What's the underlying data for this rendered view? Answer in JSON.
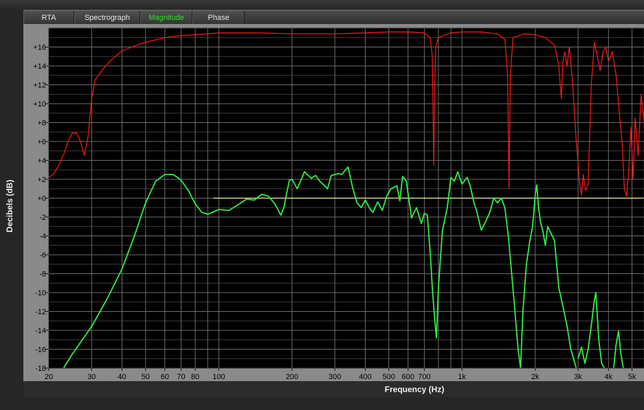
{
  "tabs": [
    {
      "label": "RTA",
      "active": false
    },
    {
      "label": "Spectrograph",
      "active": false
    },
    {
      "label": "Magnitude",
      "active": true
    },
    {
      "label": "Phase",
      "active": false
    }
  ],
  "colors": {
    "plot_bg": "#000000",
    "grid": "#6e6e6e",
    "red_trace": "#ff1a1a",
    "green_trace": "#33ee44",
    "zero_line": "#f3f39a",
    "active_tab": "#2fe02f"
  },
  "chart_data": {
    "type": "line",
    "title": "",
    "xlabel": "Frequency (Hz)",
    "ylabel": "Decibels (dB)",
    "x_scale": "log",
    "xlim": [
      20,
      5600
    ],
    "ylim": [
      -18,
      18
    ],
    "grid": true,
    "x_ticks": [
      {
        "v": 20,
        "label": "20"
      },
      {
        "v": 30,
        "label": "30"
      },
      {
        "v": 40,
        "label": "40"
      },
      {
        "v": 50,
        "label": "50"
      },
      {
        "v": 60,
        "label": "60"
      },
      {
        "v": 70,
        "label": "70"
      },
      {
        "v": 80,
        "label": "80"
      },
      {
        "v": 100,
        "label": "100"
      },
      {
        "v": 200,
        "label": "200"
      },
      {
        "v": 300,
        "label": "300"
      },
      {
        "v": 400,
        "label": "400"
      },
      {
        "v": 500,
        "label": "500"
      },
      {
        "v": 600,
        "label": "600"
      },
      {
        "v": 700,
        "label": "700"
      },
      {
        "v": 1000,
        "label": "1k"
      },
      {
        "v": 2000,
        "label": "2k"
      },
      {
        "v": 3000,
        "label": "3k"
      },
      {
        "v": 4000,
        "label": "4k"
      },
      {
        "v": 5000,
        "label": "5k"
      }
    ],
    "y_ticks": [
      {
        "v": 16,
        "label": "+16"
      },
      {
        "v": 14,
        "label": "+14"
      },
      {
        "v": 12,
        "label": "+12"
      },
      {
        "v": 10,
        "label": "+10"
      },
      {
        "v": 8,
        "label": "+8"
      },
      {
        "v": 6,
        "label": "+6"
      },
      {
        "v": 4,
        "label": "+4"
      },
      {
        "v": 2,
        "label": "+2"
      },
      {
        "v": 0,
        "label": "+0"
      },
      {
        "v": -2,
        "label": "-2"
      },
      {
        "v": -4,
        "label": "-4"
      },
      {
        "v": -6,
        "label": "-6"
      },
      {
        "v": -8,
        "label": "-8"
      },
      {
        "v": -10,
        "label": "-10"
      },
      {
        "v": -12,
        "label": "-12"
      },
      {
        "v": -14,
        "label": "-14"
      },
      {
        "v": -16,
        "label": "-16"
      },
      {
        "v": -18,
        "label": "-18"
      }
    ],
    "reference_line": {
      "y": 0,
      "x_start": 95,
      "x_end": 5600
    },
    "series": [
      {
        "color": "red",
        "points": [
          [
            20,
            2.2
          ],
          [
            21,
            2.6
          ],
          [
            22,
            3.5
          ],
          [
            23,
            4.6
          ],
          [
            24,
            6.0
          ],
          [
            25,
            6.9
          ],
          [
            26,
            6.9
          ],
          [
            27,
            6.0
          ],
          [
            28,
            4.5
          ],
          [
            29,
            6.5
          ],
          [
            30,
            10.5
          ],
          [
            31,
            12.5
          ],
          [
            33,
            13.5
          ],
          [
            36,
            14.6
          ],
          [
            40,
            15.6
          ],
          [
            45,
            16.1
          ],
          [
            50,
            16.5
          ],
          [
            60,
            17.0
          ],
          [
            70,
            17.2
          ],
          [
            80,
            17.3
          ],
          [
            100,
            17.5
          ],
          [
            150,
            17.5
          ],
          [
            200,
            17.4
          ],
          [
            300,
            17.4
          ],
          [
            400,
            17.5
          ],
          [
            500,
            17.6
          ],
          [
            600,
            17.6
          ],
          [
            700,
            17.5
          ],
          [
            740,
            17.0
          ],
          [
            755,
            15.0
          ],
          [
            765,
            3.5
          ],
          [
            772,
            12.0
          ],
          [
            780,
            16.0
          ],
          [
            800,
            17.0
          ],
          [
            900,
            17.5
          ],
          [
            1000,
            17.6
          ],
          [
            1200,
            17.6
          ],
          [
            1400,
            17.4
          ],
          [
            1500,
            16.8
          ],
          [
            1540,
            13.0
          ],
          [
            1560,
            1.0
          ],
          [
            1580,
            13.0
          ],
          [
            1620,
            17.0
          ],
          [
            1800,
            17.4
          ],
          [
            2000,
            17.3
          ],
          [
            2200,
            17.0
          ],
          [
            2400,
            16.2
          ],
          [
            2500,
            14.0
          ],
          [
            2560,
            10.5
          ],
          [
            2600,
            14.5
          ],
          [
            2650,
            15.5
          ],
          [
            2700,
            14.0
          ],
          [
            2760,
            16.0
          ],
          [
            2850,
            12.0
          ],
          [
            2950,
            6.0
          ],
          [
            3050,
            1.5
          ],
          [
            3100,
            0.3
          ],
          [
            3150,
            2.5
          ],
          [
            3220,
            0.8
          ],
          [
            3300,
            1.5
          ],
          [
            3400,
            12.0
          ],
          [
            3500,
            16.5
          ],
          [
            3600,
            15.0
          ],
          [
            3700,
            13.5
          ],
          [
            3800,
            15.5
          ],
          [
            3900,
            16.0
          ],
          [
            4000,
            14.5
          ],
          [
            4150,
            15.5
          ],
          [
            4300,
            13.0
          ],
          [
            4450,
            8.5
          ],
          [
            4550,
            6.0
          ],
          [
            4650,
            1.0
          ],
          [
            4750,
            0.2
          ],
          [
            4850,
            3.0
          ],
          [
            4950,
            7.5
          ],
          [
            5050,
            2.0
          ],
          [
            5150,
            8.5
          ],
          [
            5300,
            4.5
          ],
          [
            5450,
            11.0
          ],
          [
            5600,
            8.0
          ]
        ]
      },
      {
        "color": "green",
        "points": [
          [
            23,
            -18
          ],
          [
            25,
            -16.5
          ],
          [
            30,
            -13.6
          ],
          [
            35,
            -10.5
          ],
          [
            40,
            -7.5
          ],
          [
            45,
            -4.0
          ],
          [
            50,
            -0.5
          ],
          [
            55,
            1.8
          ],
          [
            60,
            2.5
          ],
          [
            65,
            2.5
          ],
          [
            70,
            1.9
          ],
          [
            75,
            0.8
          ],
          [
            80,
            -0.6
          ],
          [
            85,
            -1.5
          ],
          [
            90,
            -1.7
          ],
          [
            100,
            -1.2
          ],
          [
            110,
            -1.3
          ],
          [
            120,
            -0.7
          ],
          [
            130,
            -0.1
          ],
          [
            140,
            -0.2
          ],
          [
            150,
            0.4
          ],
          [
            160,
            0.2
          ],
          [
            170,
            -0.6
          ],
          [
            180,
            -1.8
          ],
          [
            185,
            -1.0
          ],
          [
            195,
            1.9
          ],
          [
            200,
            2.0
          ],
          [
            210,
            1.0
          ],
          [
            215,
            1.6
          ],
          [
            225,
            2.8
          ],
          [
            240,
            2.1
          ],
          [
            250,
            2.4
          ],
          [
            260,
            1.8
          ],
          [
            270,
            1.4
          ],
          [
            280,
            1.0
          ],
          [
            290,
            2.4
          ],
          [
            310,
            2.6
          ],
          [
            320,
            2.5
          ],
          [
            340,
            3.3
          ],
          [
            355,
            1.1
          ],
          [
            370,
            -0.5
          ],
          [
            385,
            -1.0
          ],
          [
            400,
            -0.2
          ],
          [
            420,
            -1.2
          ],
          [
            430,
            -1.5
          ],
          [
            450,
            -0.4
          ],
          [
            470,
            -1.3
          ],
          [
            490,
            0.2
          ],
          [
            510,
            1.0
          ],
          [
            540,
            1.3
          ],
          [
            555,
            -0.3
          ],
          [
            570,
            2.3
          ],
          [
            590,
            1.8
          ],
          [
            620,
            -2.1
          ],
          [
            650,
            -1.0
          ],
          [
            680,
            -2.7
          ],
          [
            700,
            -1.6
          ],
          [
            720,
            -1.8
          ],
          [
            740,
            -5.8
          ],
          [
            755,
            -9.5
          ],
          [
            770,
            -12.5
          ],
          [
            785,
            -14.8
          ],
          [
            800,
            -9.5
          ],
          [
            830,
            -3.5
          ],
          [
            870,
            -1.0
          ],
          [
            900,
            2.2
          ],
          [
            930,
            1.8
          ],
          [
            960,
            2.8
          ],
          [
            1000,
            1.5
          ],
          [
            1050,
            2.2
          ],
          [
            1080,
            1.3
          ],
          [
            1120,
            -0.5
          ],
          [
            1150,
            -1.4
          ],
          [
            1200,
            -3.4
          ],
          [
            1250,
            -2.5
          ],
          [
            1300,
            -1.5
          ],
          [
            1350,
            0.0
          ],
          [
            1400,
            -0.5
          ],
          [
            1450,
            0.0
          ],
          [
            1500,
            -1.0
          ],
          [
            1550,
            -4.0
          ],
          [
            1600,
            -8.0
          ],
          [
            1650,
            -12.0
          ],
          [
            1700,
            -16.0
          ],
          [
            1740,
            -18.0
          ]
        ]
      },
      {
        "color": "green",
        "points": [
          [
            1740,
            -18.0
          ],
          [
            1780,
            -12.0
          ],
          [
            1840,
            -7.0
          ],
          [
            1900,
            -4.5
          ],
          [
            1950,
            -3.0
          ],
          [
            2000,
            0.4
          ],
          [
            2030,
            1.4
          ],
          [
            2060,
            -0.8
          ],
          [
            2100,
            -2.5
          ],
          [
            2150,
            -3.5
          ],
          [
            2200,
            -5.0
          ],
          [
            2250,
            -3.0
          ],
          [
            2300,
            -3.5
          ],
          [
            2400,
            -4.5
          ],
          [
            2500,
            -9.5
          ],
          [
            2600,
            -11.5
          ],
          [
            2700,
            -13.5
          ],
          [
            2800,
            -16.0
          ],
          [
            2950,
            -18.0
          ]
        ]
      },
      {
        "color": "green",
        "points": [
          [
            3000,
            -17.0
          ],
          [
            3100,
            -15.8
          ],
          [
            3200,
            -17.5
          ],
          [
            3300,
            -16.0
          ],
          [
            3400,
            -13.5
          ],
          [
            3500,
            -10.8
          ],
          [
            3550,
            -10.0
          ],
          [
            3600,
            -12.5
          ],
          [
            3650,
            -15.0
          ],
          [
            3750,
            -17.5
          ],
          [
            3850,
            -18.0
          ]
        ]
      },
      {
        "color": "green",
        "points": [
          [
            4200,
            -18.0
          ],
          [
            4300,
            -15.5
          ],
          [
            4400,
            -14.1
          ],
          [
            4500,
            -16.5
          ],
          [
            4600,
            -18.0
          ]
        ]
      }
    ]
  }
}
